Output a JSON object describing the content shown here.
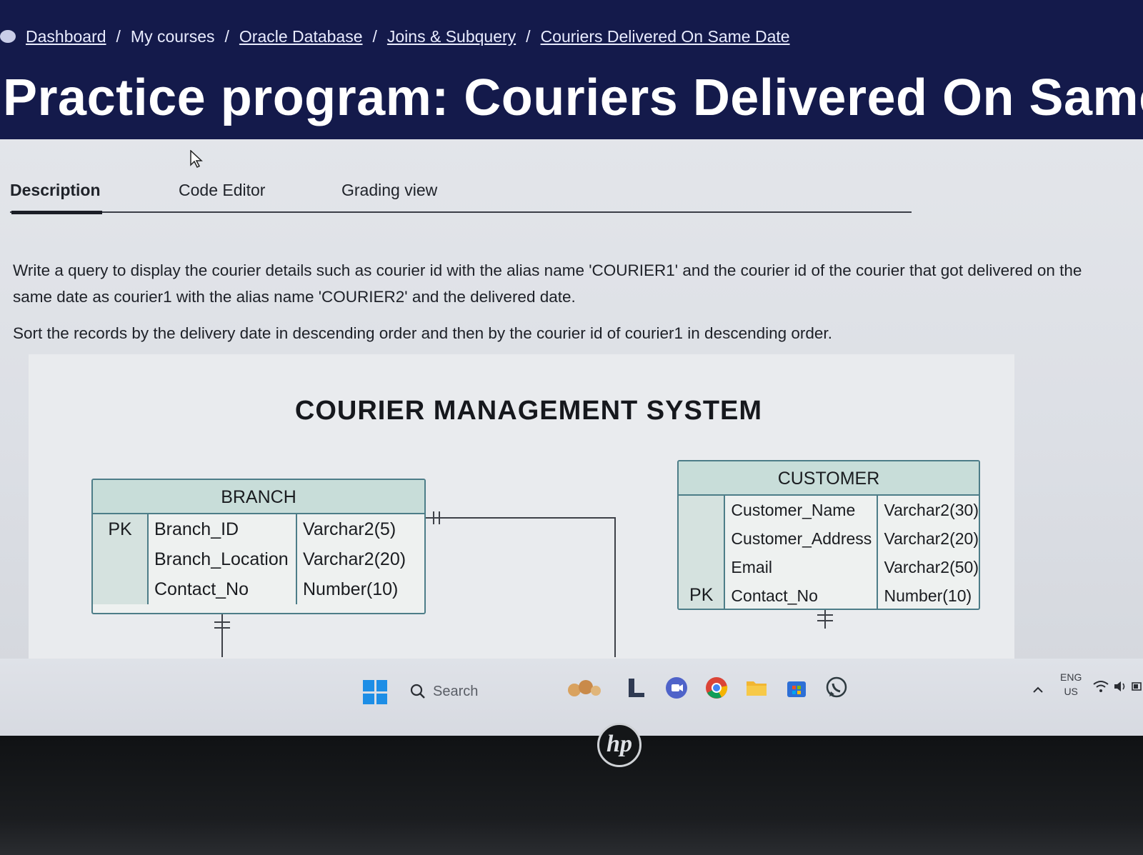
{
  "breadcrumb": {
    "dashboard": "Dashboard",
    "sep": "/",
    "my_courses": "My courses",
    "course": "Oracle Database",
    "topic": "Joins & Subquery",
    "current": "Couriers Delivered On Same Date"
  },
  "page_title": "Practice program: Couriers Delivered On Same Date",
  "tabs": [
    {
      "label": "Description",
      "active": true
    },
    {
      "label": "Code Editor",
      "active": false
    },
    {
      "label": "Grading view",
      "active": false
    }
  ],
  "description": {
    "paragraph1": "Write a query to display the courier details such as courier id with the alias name 'COURIER1' and the courier id of the courier that got delivered on the same date as courier1 with the alias name 'COURIER2' and the delivered date.",
    "paragraph2": "Sort the records by the delivery date in descending order and then by the courier id of courier1 in descending order."
  },
  "erd": {
    "title": "COURIER MANAGEMENT SYSTEM",
    "branch": {
      "name": "BRANCH",
      "pk_label": "PK",
      "fields": [
        {
          "name": "Branch_ID",
          "type": "Varchar2(5)"
        },
        {
          "name": "Branch_Location",
          "type": "Varchar2(20)"
        },
        {
          "name": "Contact_No",
          "type": "Number(10)"
        }
      ]
    },
    "customer": {
      "name": "CUSTOMER",
      "pk_label": "PK",
      "fields": [
        {
          "name": "Customer_Name",
          "type": "Varchar2(30)"
        },
        {
          "name": "Customer_Address",
          "type": "Varchar2(20)"
        },
        {
          "name": "Email",
          "type": "Varchar2(50)"
        },
        {
          "name": "Contact_No",
          "type": "Number(10)"
        }
      ]
    }
  },
  "taskbar": {
    "search_placeholder": "Search",
    "language": "ENG",
    "region": "US",
    "icons": [
      "windows-start-icon",
      "search-icon",
      "widgets-icon",
      "file-icon",
      "meet-icon",
      "chrome-icon",
      "file-explorer-icon",
      "microsoft-store-icon",
      "whatsapp-icon"
    ]
  },
  "colors": {
    "hero_bg": "#141a4b",
    "erd_header": "#c8ddd9",
    "erd_border": "#4d7d88"
  },
  "laptop_brand": "hp"
}
